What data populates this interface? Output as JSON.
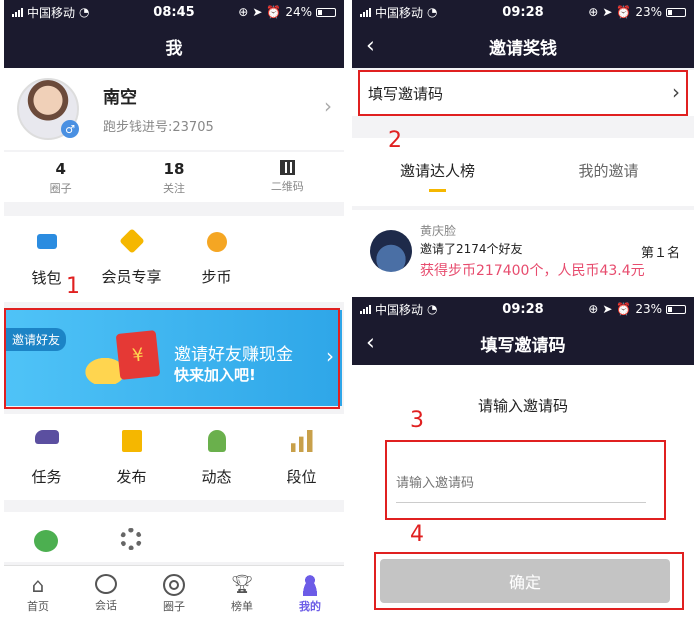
{
  "status": {
    "carrier": "中国移动",
    "battery_pct": 0.24
  },
  "left": {
    "status": {
      "time": "08:45",
      "battery": "24%"
    },
    "title": "我",
    "profile": {
      "name": "南空",
      "id_label": "跑步钱进号:23705"
    },
    "stats": [
      {
        "value": "4",
        "label": "圈子"
      },
      {
        "value": "18",
        "label": "关注"
      },
      {
        "value": "",
        "label": "二维码"
      }
    ],
    "menu1": [
      {
        "label": "钱包"
      },
      {
        "label": "会员专享"
      },
      {
        "label": "步币"
      }
    ],
    "banner": {
      "tag": "邀请好友",
      "line1": "邀请好友赚现金",
      "line2": "快来加入吧!",
      "coin_symbol": "¥"
    },
    "menu2": [
      {
        "label": "任务"
      },
      {
        "label": "发布"
      },
      {
        "label": "动态"
      },
      {
        "label": "段位"
      }
    ],
    "tabbar": [
      {
        "label": "首页"
      },
      {
        "label": "会话"
      },
      {
        "label": "圈子"
      },
      {
        "label": "榜单"
      },
      {
        "label": "我的"
      }
    ]
  },
  "right_top": {
    "status": {
      "time": "09:28",
      "battery": "23%"
    },
    "title": "邀请奖钱",
    "fill_code": "填写邀请码",
    "tabs": [
      {
        "label": "邀请达人榜"
      },
      {
        "label": "我的邀请"
      }
    ],
    "rank": {
      "name": "黄庆脸",
      "invites": "邀请了2174个好友",
      "reward": "获得步币217400个，人民币43.4元",
      "position": "第１名"
    }
  },
  "right_bottom": {
    "status": {
      "time": "09:28",
      "battery": "23%"
    },
    "title": "填写邀请码",
    "prompt": "请输入邀请码",
    "input_placeholder": "请输入邀请码",
    "confirm": "确定"
  },
  "annotations": [
    "1",
    "2",
    "3",
    "4"
  ],
  "colors": {
    "navbar": "#1b1a2e",
    "accent": "#6c5ce7",
    "annotation": "#e02020",
    "reward": "#e74c6e",
    "banner": "#2ea6e8"
  }
}
